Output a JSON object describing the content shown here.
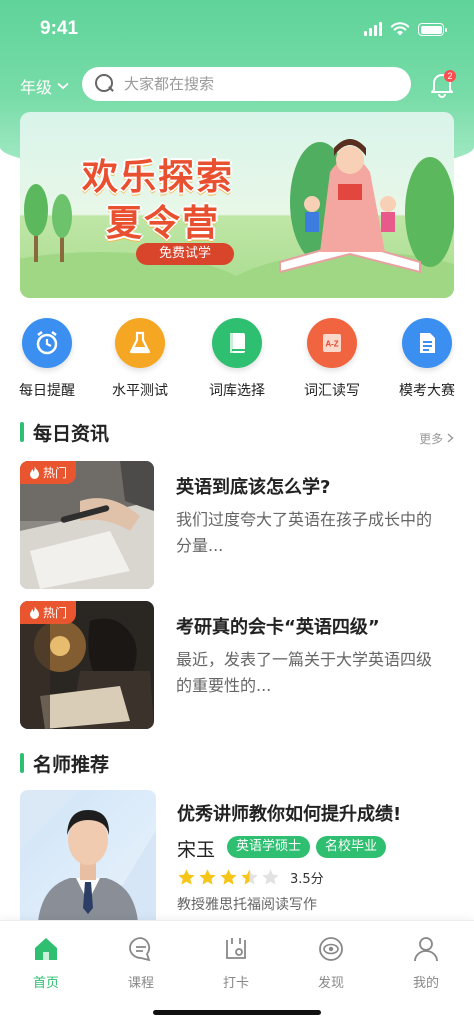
{
  "status_bar": {
    "time": "9:41"
  },
  "header": {
    "grade_label": "年级",
    "search_placeholder": "大家都在搜索",
    "notification_count": "2"
  },
  "banner": {
    "title_line1": "欢乐探索",
    "title_line2": "夏令营",
    "cta": "免费试学"
  },
  "quick_nav": [
    {
      "label": "每日提醒",
      "icon": "alarm-clock-icon",
      "color": "#3b8ff0"
    },
    {
      "label": "水平测试",
      "icon": "flask-icon",
      "color": "#f5a623"
    },
    {
      "label": "词库选择",
      "icon": "book-icon",
      "color": "#2fbf71"
    },
    {
      "label": "词汇读写",
      "icon": "a-z-card-icon",
      "color": "#f0653f"
    },
    {
      "label": "模考大赛",
      "icon": "document-icon",
      "color": "#3b8ff0"
    }
  ],
  "daily_news": {
    "title": "每日资讯",
    "more": "更多",
    "items": [
      {
        "tag": "热门",
        "title": "英语到底该怎么学?",
        "desc": "我们过度夸大了英语在孩子成长中的分量..."
      },
      {
        "tag": "热门",
        "title": "考研真的会卡“英语四级”",
        "desc": "最近，发表了一篇关于大学英语四级的重要性的..."
      }
    ]
  },
  "teachers": {
    "title": "名师推荐",
    "item": {
      "headline": "优秀讲师教你如何提升成绩!",
      "name": "宋玉",
      "tags": [
        "英语学硕士",
        "名校毕业"
      ],
      "rating": 3.5,
      "score_text": "3.5分",
      "desc": "教授雅思托福阅读写作"
    }
  },
  "tabbar": [
    {
      "label": "首页",
      "icon": "home-icon",
      "active": true
    },
    {
      "label": "课程",
      "icon": "chat-bubble-icon",
      "active": false
    },
    {
      "label": "打卡",
      "icon": "check-in-icon",
      "active": false
    },
    {
      "label": "发现",
      "icon": "eye-icon",
      "active": false
    },
    {
      "label": "我的",
      "icon": "user-icon",
      "active": false
    }
  ],
  "colors": {
    "accent": "#2fbf71",
    "hot": "#e8552e",
    "header": "#5fd39a"
  }
}
